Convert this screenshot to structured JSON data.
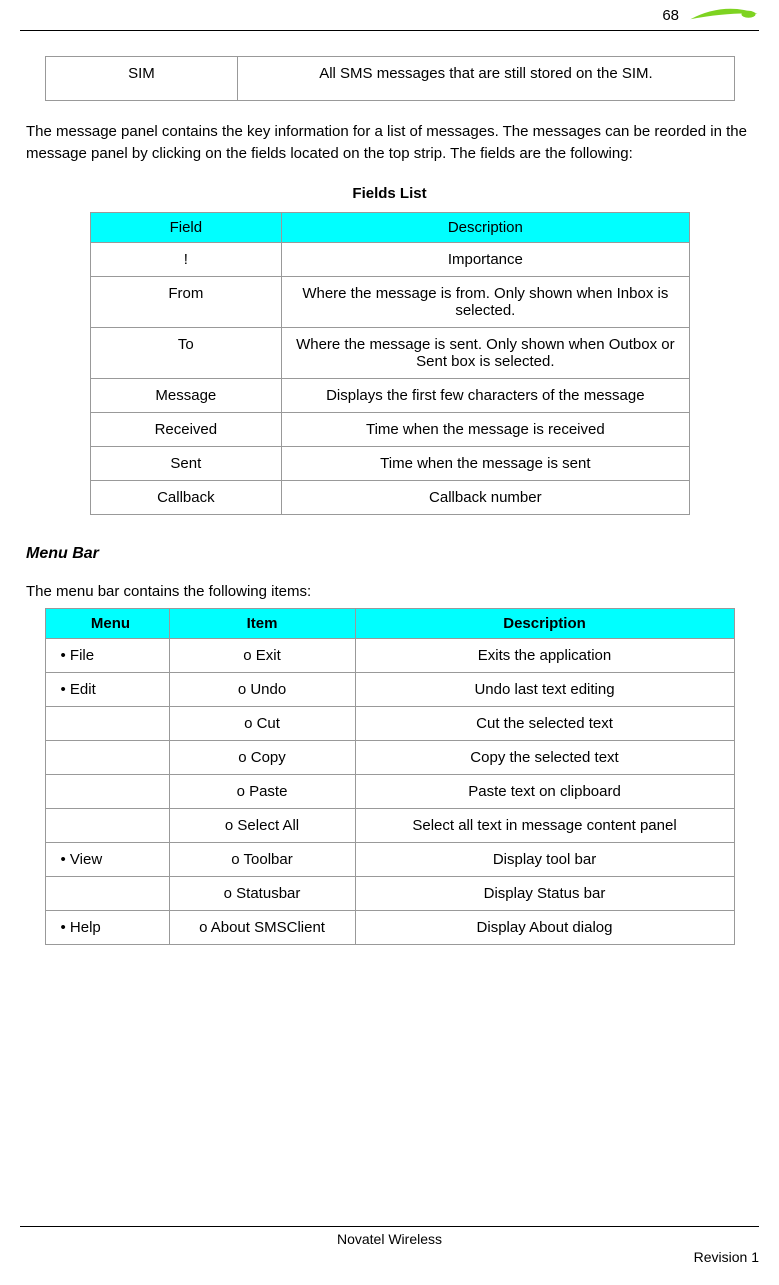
{
  "header": {
    "page_number": "68"
  },
  "top_table": {
    "col1": "SIM",
    "col2": "All SMS messages that are still stored on the SIM."
  },
  "paragraph1": "The message panel contains the key information for a list of messages.  The messages can be reorded in the message panel by clicking on the fields located on the top strip.  The fields are the following:",
  "fields_list": {
    "title": "Fields List",
    "headers": {
      "c1": "Field",
      "c2": "Description"
    },
    "rows": [
      {
        "c1": "!",
        "c2": "Importance"
      },
      {
        "c1": "From",
        "c2": "Where the message is from. Only shown when Inbox is selected."
      },
      {
        "c1": "To",
        "c2": "Where the message is sent. Only shown when Outbox or Sent box is selected."
      },
      {
        "c1": "Message",
        "c2": "Displays the first few characters of the message"
      },
      {
        "c1": "Received",
        "c2": "Time when the message is received"
      },
      {
        "c1": "Sent",
        "c2": "Time when the message is sent"
      },
      {
        "c1": "Callback",
        "c2": "Callback number"
      }
    ]
  },
  "menu_bar": {
    "heading": "Menu Bar",
    "intro": "The menu bar contains the following items:",
    "headers": {
      "c1": "Menu",
      "c2": "Item",
      "c3": "Description"
    },
    "rows": [
      {
        "c1": "• File",
        "c2": "o Exit",
        "c3": "Exits the application"
      },
      {
        "c1": "• Edit",
        "c2": "o Undo",
        "c3": "Undo last text editing"
      },
      {
        "c1": "",
        "c2": "o Cut",
        "c3": "Cut the selected text"
      },
      {
        "c1": "",
        "c2": "o Copy",
        "c3": "Copy the selected text"
      },
      {
        "c1": "",
        "c2": "o Paste",
        "c3": "Paste text on clipboard"
      },
      {
        "c1": "",
        "c2": "o Select All",
        "c3": "Select all text in message content panel"
      },
      {
        "c1": "• View",
        "c2": "o Toolbar",
        "c3": "Display tool bar"
      },
      {
        "c1": "",
        "c2": "o Statusbar",
        "c3": "Display Status bar"
      },
      {
        "c1": "• Help",
        "c2": "o About SMSClient",
        "c3": "Display About dialog"
      }
    ]
  },
  "footer": {
    "center": "Novatel Wireless",
    "right": "Revision 1"
  }
}
